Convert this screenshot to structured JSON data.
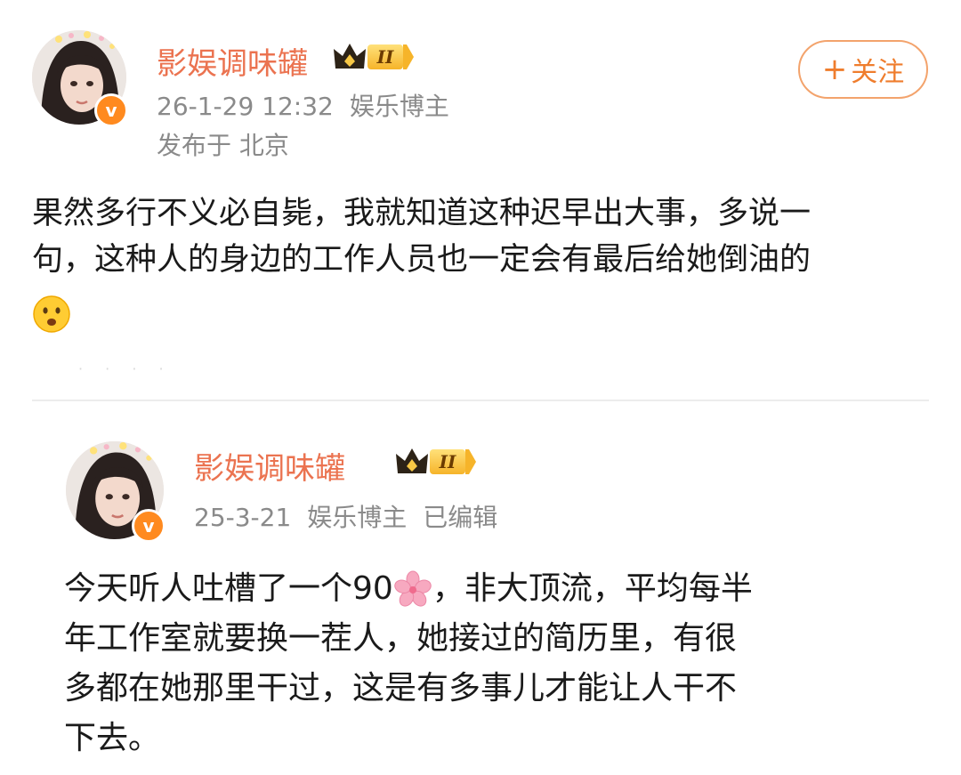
{
  "post": {
    "username": "影娱调味罐",
    "level": "II",
    "time": "26-1-29 12:32",
    "tag": "娱乐博主",
    "location": "发布于 北京",
    "follow_plus": "+",
    "follow_label": "关注",
    "text_line1": "果然多行不义必自毙，我就知道这种迟早出大事，多说一",
    "text_line2": "句，这种人的身边的工作人员也一定会有最后给她倒油的",
    "emoji": "frowning-face-emoji"
  },
  "quoted": {
    "username": "影娱调味罐",
    "level": "II",
    "time": "25-3-21",
    "tag": "娱乐博主",
    "edited": "已编辑",
    "text_line1_a": "今天听人吐槽了一个90",
    "text_line1_b": "，非大顶流，平均每半",
    "text_line2": "年工作室就要换一茬人，她接过的简历里，有很",
    "text_line3": "多都在她那里干过，这是有多事儿才能让人干不",
    "text_line4": "下去。",
    "emoji": "cherry-blossom-emoji"
  },
  "colors": {
    "username": "#eb7350",
    "follow": "#ef7d2d",
    "meta": "#8a8a8a",
    "verified": "#ff8a1f"
  }
}
